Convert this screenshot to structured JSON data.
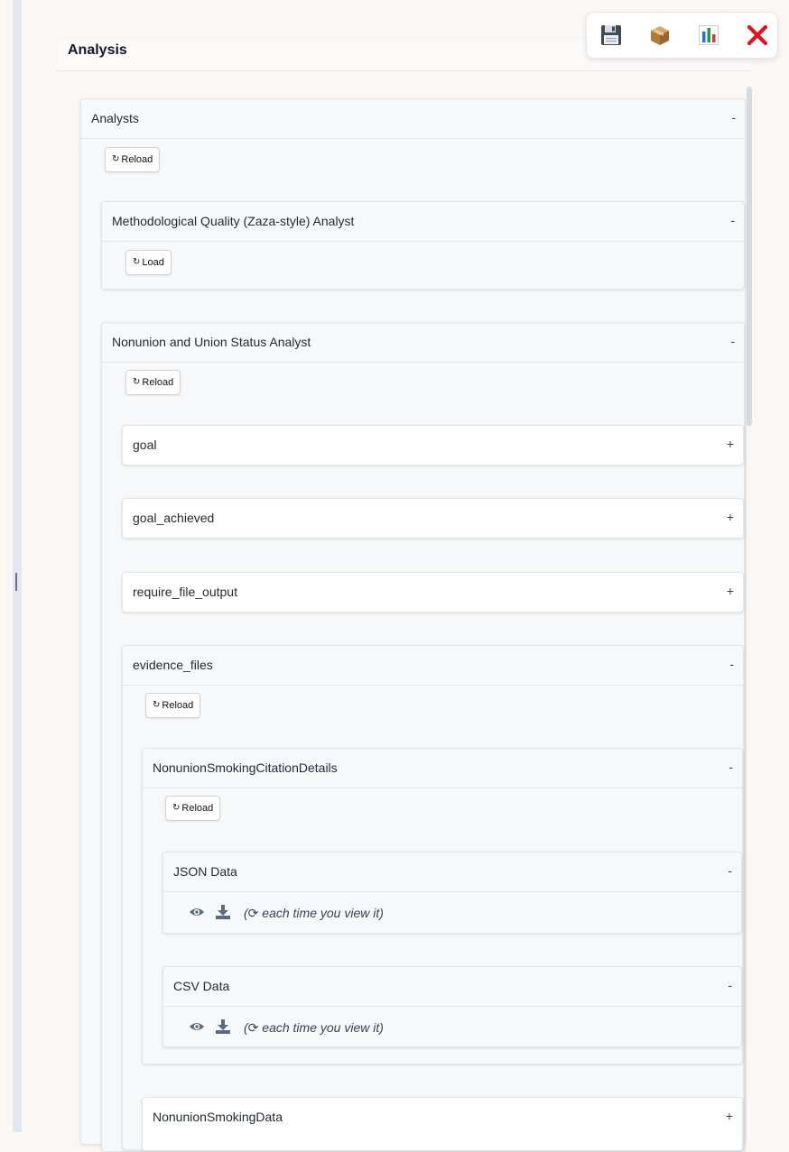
{
  "header": {
    "title": "Analysis"
  },
  "toolbar": {
    "save_icon": "floppy-disk-icon",
    "package_icon": "package-icon",
    "chart_icon": "bar-chart-icon",
    "close_icon": "close-icon"
  },
  "analysts": {
    "title": "Analysts",
    "toggle": "-",
    "reload_label": "Reload",
    "reload_glyph": "↻"
  },
  "methodological": {
    "title": "Methodological Quality (Zaza-style) Analyst",
    "toggle": "-",
    "load_label": "Load",
    "load_glyph": "↻"
  },
  "nonunion": {
    "title": "Nonunion and Union Status Analyst",
    "toggle": "-",
    "reload_label": "Reload",
    "reload_glyph": "↻",
    "fields": [
      {
        "title": "goal",
        "toggle": "+"
      },
      {
        "title": "goal_achieved",
        "toggle": "+"
      },
      {
        "title": "require_file_output",
        "toggle": "+"
      }
    ],
    "evidence_files": {
      "title": "evidence_files",
      "toggle": "-",
      "reload_label": "Reload",
      "reload_glyph": "↻",
      "citation_details": {
        "title": "NonunionSmokingCitationDetails",
        "toggle": "-",
        "reload_label": "Reload",
        "reload_glyph": "↻",
        "json_data": {
          "title": "JSON Data",
          "toggle": "-",
          "note": "(⟳ each time you view it)"
        },
        "csv_data": {
          "title": "CSV Data",
          "toggle": "-",
          "note": "(⟳ each time you view it)"
        }
      },
      "smoking_data": {
        "title": "NonunionSmokingData",
        "toggle": "+"
      }
    }
  }
}
